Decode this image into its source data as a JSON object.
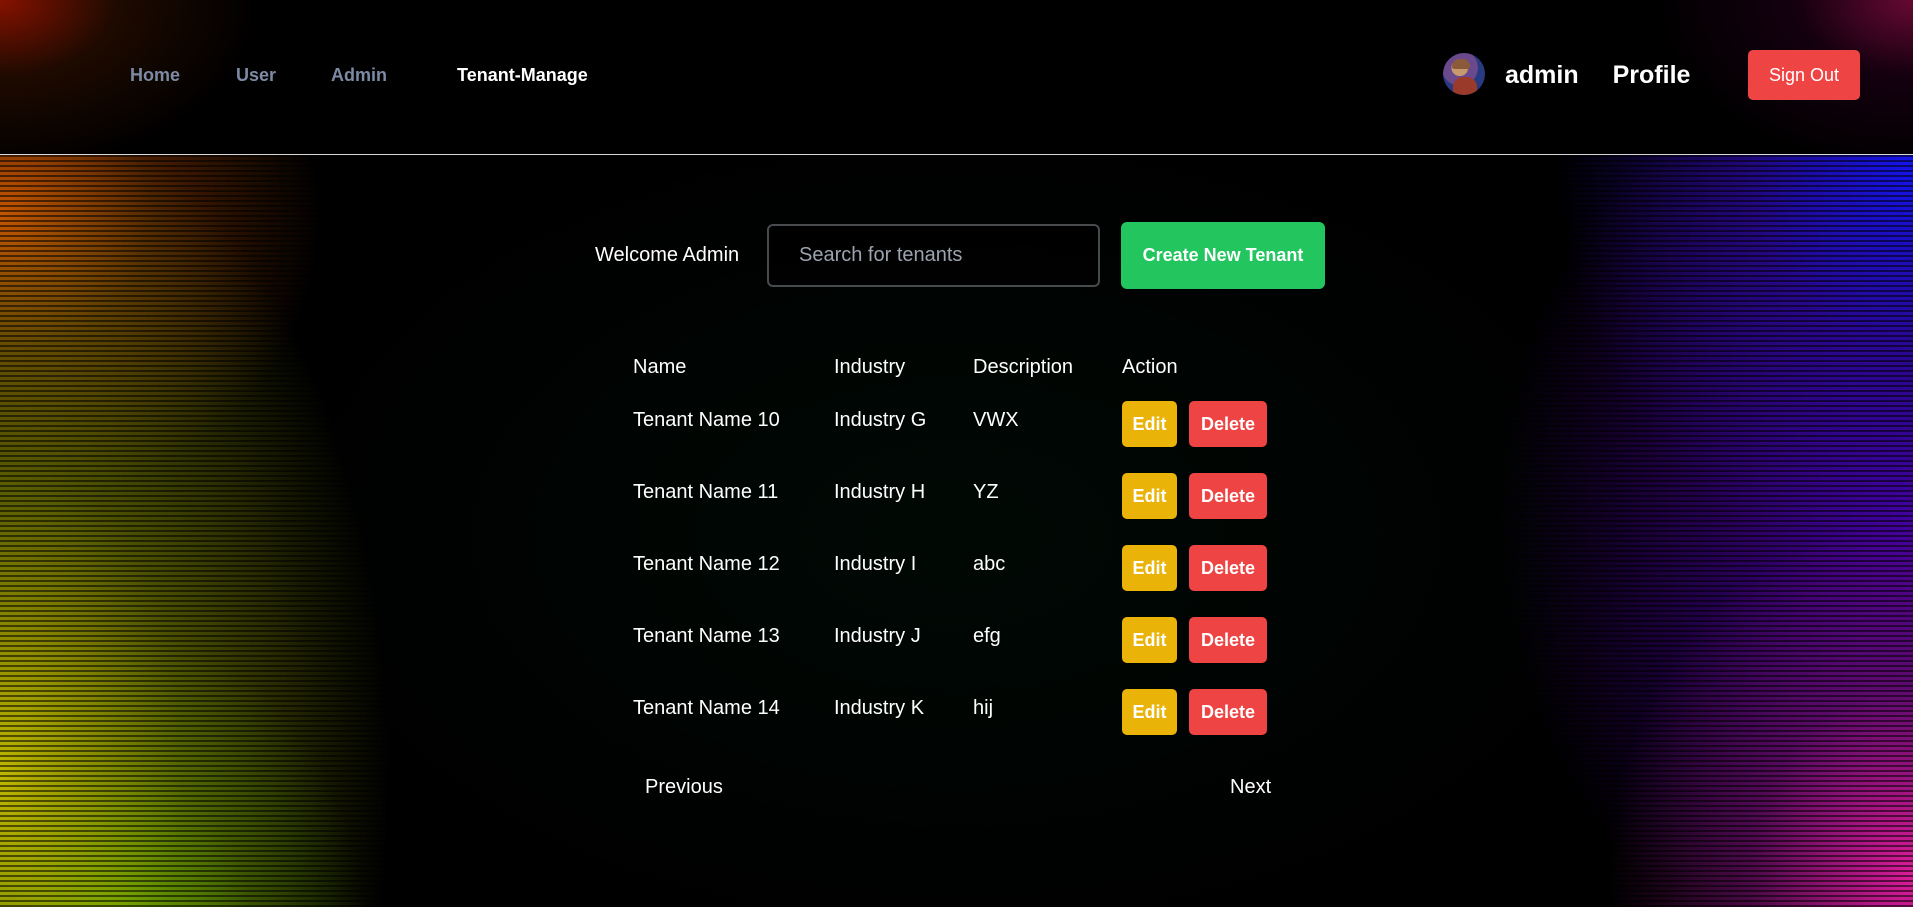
{
  "nav": {
    "items": [
      {
        "label": "Home"
      },
      {
        "label": "User"
      },
      {
        "label": "Admin"
      },
      {
        "label": "Tenant-Manage"
      }
    ],
    "active_index": 3
  },
  "user": {
    "name": "admin",
    "profile_label": "Profile",
    "signout_label": "Sign Out"
  },
  "toolbar": {
    "welcome_text": "Welcome Admin",
    "search_placeholder": "Search for tenants",
    "search_value": "",
    "create_label": "Create New Tenant"
  },
  "table": {
    "headers": {
      "name": "Name",
      "industry": "Industry",
      "description": "Description",
      "action": "Action"
    },
    "rows": [
      {
        "name": "Tenant Name 10",
        "industry": "Industry G",
        "description": "VWX",
        "edit_label": "Edit",
        "delete_label": "Delete"
      },
      {
        "name": "Tenant Name 11",
        "industry": "Industry H",
        "description": "YZ",
        "edit_label": "Edit",
        "delete_label": "Delete"
      },
      {
        "name": "Tenant Name 12",
        "industry": "Industry I",
        "description": "abc",
        "edit_label": "Edit",
        "delete_label": "Delete"
      },
      {
        "name": "Tenant Name 13",
        "industry": "Industry J",
        "description": "efg",
        "edit_label": "Edit",
        "delete_label": "Delete"
      },
      {
        "name": "Tenant Name 14",
        "industry": "Industry K",
        "description": "hij",
        "edit_label": "Edit",
        "delete_label": "Delete"
      }
    ]
  },
  "pagination": {
    "previous_label": "Previous",
    "next_label": "Next"
  },
  "colors": {
    "signout": "#ef4444",
    "create": "#22c55e",
    "edit": "#eab308",
    "delete": "#ef4444",
    "nav_inactive": "#7d8aa3",
    "nav_active": "#ffffff"
  },
  "icons": {
    "avatar": "user-avatar-image"
  }
}
